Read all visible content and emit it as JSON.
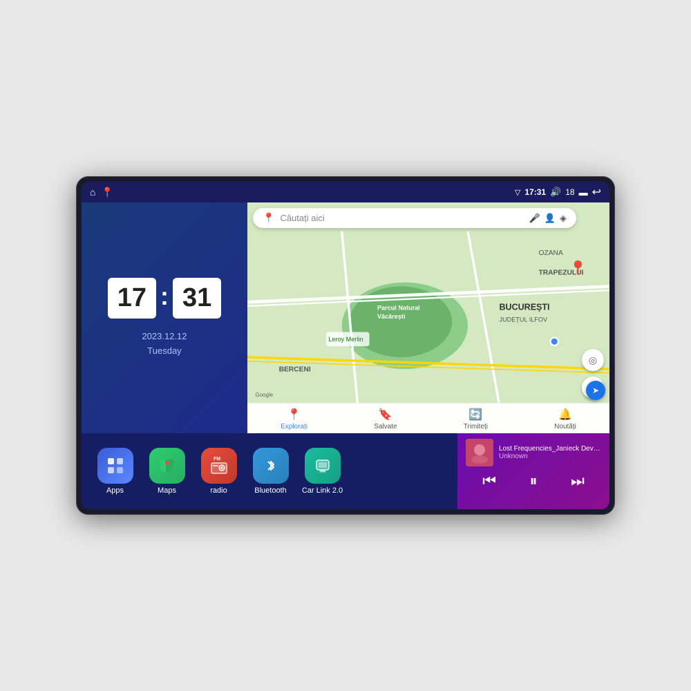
{
  "device": {
    "status_bar": {
      "left_icons": [
        "home",
        "maps"
      ],
      "time": "17:31",
      "signal_icon": "▽",
      "volume_icon": "🔊",
      "battery_level": "18",
      "battery_icon": "▬",
      "back_icon": "↩"
    }
  },
  "clock": {
    "hours": "17",
    "minutes": "31",
    "date": "2023.12.12",
    "day": "Tuesday"
  },
  "map": {
    "search_placeholder": "Căutați aici",
    "nav_items": [
      {
        "label": "Explorați",
        "icon": "📍",
        "active": true
      },
      {
        "label": "Salvate",
        "icon": "🔖",
        "active": false
      },
      {
        "label": "Trimiteți",
        "icon": "🔄",
        "active": false
      },
      {
        "label": "Noutăți",
        "icon": "🔔",
        "active": false
      }
    ],
    "place_label": "Parcul Natural Văcărești",
    "area_label": "BUCUREȘTI",
    "area_sub": "JUDEȚUL ILFOV",
    "road_label": "BERCENI",
    "trap_label": "TRAPEZULUI",
    "ozana_label": "OZANA"
  },
  "apps": [
    {
      "id": "apps",
      "label": "Apps",
      "icon": "⊞",
      "color_class": "apps-icon-bg"
    },
    {
      "id": "maps",
      "label": "Maps",
      "icon": "🗺",
      "color_class": "maps-icon-bg"
    },
    {
      "id": "radio",
      "label": "radio",
      "icon": "📻",
      "color_class": "radio-icon-bg"
    },
    {
      "id": "bluetooth",
      "label": "Bluetooth",
      "icon": "⚡",
      "color_class": "bt-icon-bg"
    },
    {
      "id": "carlink",
      "label": "Car Link 2.0",
      "icon": "📱",
      "color_class": "carlink-icon-bg"
    }
  ],
  "music": {
    "title": "Lost Frequencies_Janieck Devy-...",
    "artist": "Unknown",
    "prev_label": "⏮",
    "play_label": "⏸",
    "next_label": "⏭"
  }
}
